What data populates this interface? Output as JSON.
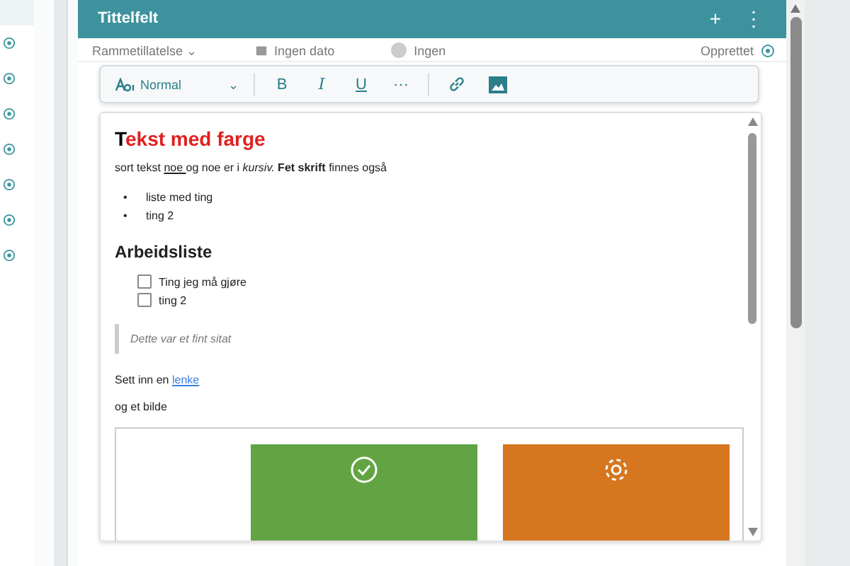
{
  "sidebar": {
    "items": [
      {
        "selected": true
      },
      {
        "selected": false
      },
      {
        "selected": false
      },
      {
        "selected": false
      },
      {
        "selected": false
      },
      {
        "selected": false
      },
      {
        "selected": false
      },
      {
        "selected": false
      }
    ]
  },
  "header": {
    "title": "Tittelfelt",
    "add": "+",
    "more": "⋮"
  },
  "meta": {
    "type": "Rammetillatelse",
    "type_caret": "⌄",
    "date": "Ingen dato",
    "assignee": "Ingen",
    "status": "Opprettet"
  },
  "toolbar": {
    "format": "Normal",
    "format_caret": "⌄",
    "bold": "B",
    "italic": "I",
    "underline": "U",
    "more": "···"
  },
  "editor": {
    "heading": [
      {
        "text": "T",
        "color": "#000000"
      },
      {
        "text": "ekst med farge",
        "color": "#e02020"
      }
    ],
    "paragraph": [
      {
        "text": "sort tekst ",
        "kind": "plain"
      },
      {
        "text": "noe ",
        "kind": "underline"
      },
      {
        "text": " og noe er i ",
        "kind": "plain"
      },
      {
        "text": "kursiv.",
        "kind": "italic"
      },
      {
        "text": "  Fet skrift",
        "kind": "bold"
      },
      {
        "text": " finnes også",
        "kind": "plain"
      }
    ],
    "bullets": [
      {
        "marker": "•",
        "text": "liste med ting"
      },
      {
        "marker": "•",
        "text": "ting 2"
      }
    ],
    "subheading": "Arbeidsliste",
    "tasks": [
      {
        "label": "Ting jeg må gjøre",
        "checked": false
      },
      {
        "label": "ting 2",
        "checked": false
      }
    ],
    "quote": "Dette var et fint sitat",
    "link_prefix": "Sett inn en ",
    "link": "lenke",
    "image_caption": "og et bilde",
    "tiles": [
      {
        "kind": "check",
        "color": "#62a444"
      },
      {
        "kind": "gear",
        "color": "#d6761f"
      }
    ]
  }
}
